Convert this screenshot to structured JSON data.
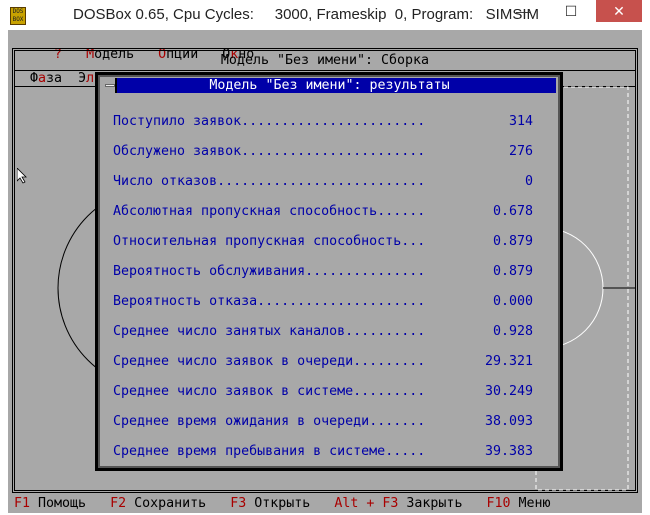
{
  "window": {
    "title": "DOSBox 0.65, Cpu Cycles:     3000, Frameskip  0, Program:   SIMSIM",
    "icon_text": "DOS BOX",
    "minimize": "—",
    "maximize": "☐",
    "close": "✕"
  },
  "menubar": [
    {
      "hot": "?",
      "rest": ""
    },
    {
      "hot": "М",
      "rest": "одель"
    },
    {
      "hot": "О",
      "rest": "пции"
    },
    {
      "pre": "О",
      "hot": "к",
      "rest": "но"
    }
  ],
  "outer": {
    "title": "Модель \"Без имени\": Сборка",
    "menu": [
      {
        "pre": "Ф",
        "hot": "а",
        "rest": "за"
      },
      {
        "pre": "Э",
        "hot": "л",
        "rest": ""
      }
    ]
  },
  "dialog": {
    "title": "Модель \"Без имени\": результаты",
    "rows": [
      {
        "label": "Поступило заявок",
        "value": "314"
      },
      {
        "label": "Обслужено заявок",
        "value": "276"
      },
      {
        "label": "Число отказов",
        "value": "0"
      },
      {
        "label": "Абсолютная пропускная способность",
        "value": "0.678"
      },
      {
        "label": "Относительная пропускная способность",
        "value": "0.879"
      },
      {
        "label": "Вероятность обслуживания",
        "value": "0.879"
      },
      {
        "label": "Вероятность отказа",
        "value": "0.000"
      },
      {
        "label": "Среднее число занятых каналов",
        "value": "0.928"
      },
      {
        "label": "Среднее число заявок в очереди",
        "value": "29.321"
      },
      {
        "label": "Среднее число заявок в системе",
        "value": "30.249"
      },
      {
        "label": "Среднее время ожидания в очереди",
        "value": "38.093"
      },
      {
        "label": "Среднее время пребывания в системе",
        "value": "39.383"
      }
    ]
  },
  "statusbar": [
    {
      "key": "F1",
      "label": "Помощь"
    },
    {
      "key": "F2",
      "label": "Сохранить"
    },
    {
      "key": "F3",
      "label": "Открыть"
    },
    {
      "key": "Alt + F3",
      "label": "Закрыть"
    },
    {
      "key": "F10",
      "label": "Меню"
    }
  ]
}
